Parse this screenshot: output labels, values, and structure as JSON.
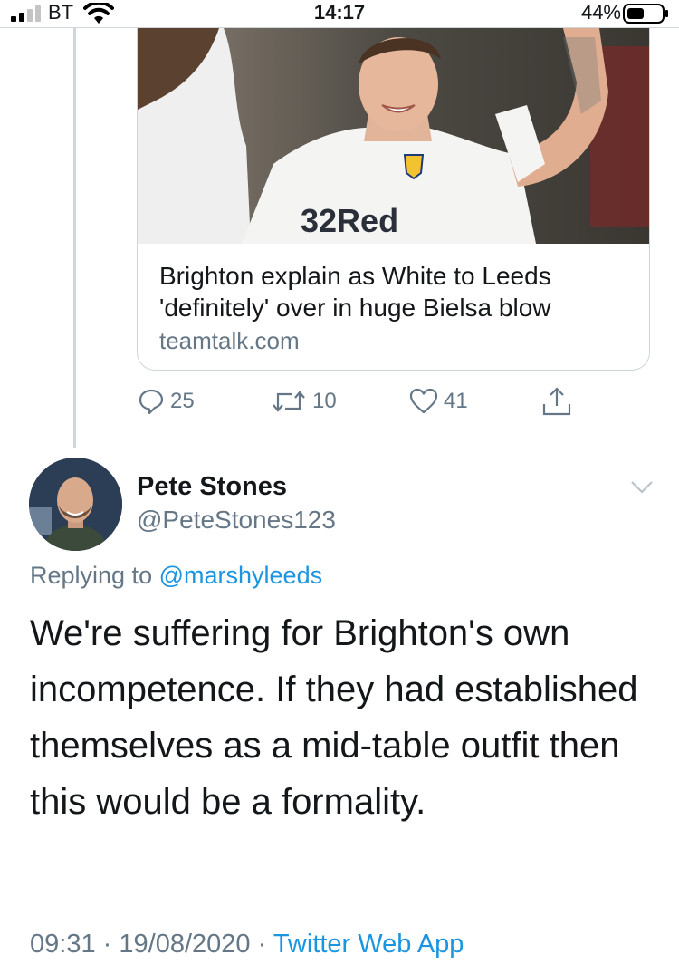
{
  "status_bar": {
    "carrier": "BT",
    "time": "14:17",
    "battery_percent": "44%"
  },
  "link_card": {
    "image_alt": "Footballer in white Leeds shirt celebrating",
    "image_shirt_sponsor": "32Red",
    "title": "Brighton explain as White to Leeds 'definitely' over in huge Bielsa blow",
    "domain": "teamtalk.com"
  },
  "quoted_actions": {
    "replies": "25",
    "retweets": "10",
    "likes": "41"
  },
  "tweet": {
    "display_name": "Pete Stones",
    "handle": "@PeteStones123",
    "replying_prefix": "Replying to",
    "replying_mention": "@marshyleeds",
    "text": "We're suffering for Brighton's own incompetence. If they had established themselves as a mid-table outfit then this would be a formality.",
    "time": "09:31",
    "date": "19/08/2020",
    "separator": "·",
    "source": "Twitter Web App"
  },
  "colors": {
    "accent": "#1b95e0",
    "secondary_text": "#657786",
    "border": "#ccd6dd"
  },
  "icons": {
    "reply": "reply-icon",
    "retweet": "retweet-icon",
    "like": "heart-icon",
    "share": "share-icon",
    "more": "chevron-down-icon"
  }
}
